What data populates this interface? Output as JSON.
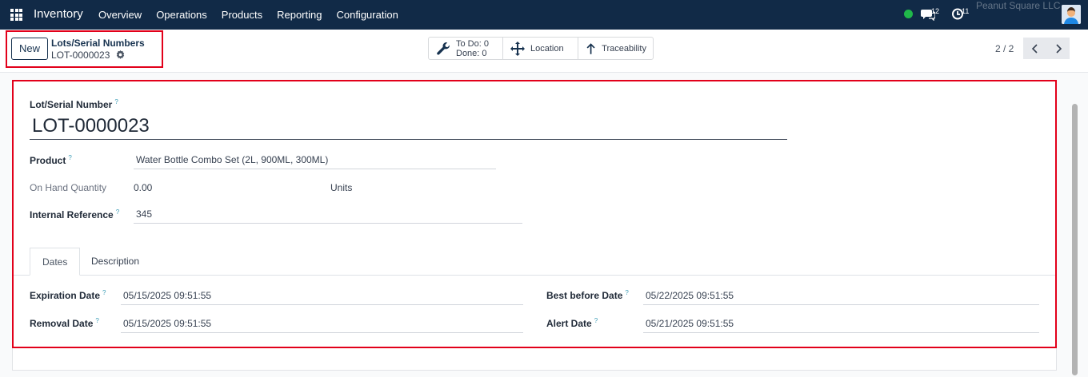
{
  "navbar": {
    "app_name": "Inventory",
    "menu": [
      "Overview",
      "Operations",
      "Products",
      "Reporting",
      "Configuration"
    ],
    "messages_count": "12",
    "activities_count": "11",
    "company": "Peanut Square LLC",
    "status_color": "#20b84a"
  },
  "control_panel": {
    "new_label": "New",
    "breadcrumb_parent": "Lots/Serial Numbers",
    "breadcrumb_current": "LOT-0000023",
    "smart_buttons": {
      "todo_label": "To Do: 0",
      "done_label": "Done: 0",
      "location_label": "Location",
      "traceability_label": "Traceability"
    },
    "pager": "2 / 2"
  },
  "form": {
    "lot_label": "Lot/Serial Number",
    "lot_value": "LOT-0000023",
    "help_mark": "?",
    "product_label": "Product",
    "product_value": "Water Bottle Combo Set (2L, 900ML, 300ML)",
    "on_hand_label": "On Hand Quantity",
    "on_hand_value": "0.00",
    "on_hand_uom": "Units",
    "internal_ref_label": "Internal Reference",
    "internal_ref_value": "345"
  },
  "tabs": [
    "Dates",
    "Description"
  ],
  "dates": {
    "expiration_label": "Expiration Date",
    "expiration_value": "05/15/2025 09:51:55",
    "removal_label": "Removal Date",
    "removal_value": "05/15/2025 09:51:55",
    "best_before_label": "Best before Date",
    "best_before_value": "05/22/2025 09:51:55",
    "alert_label": "Alert Date",
    "alert_value": "05/21/2025 09:51:55"
  },
  "icons": [
    "apps-grid-icon",
    "chat-icon",
    "activity-clock-icon",
    "avatar",
    "gear-icon",
    "wrench-icon",
    "move-arrows-icon",
    "arrow-up-icon",
    "chevron-left-icon",
    "chevron-right-icon"
  ],
  "colors": {
    "navbar": "#112a47",
    "highlight": "#e2001a",
    "help": "#3a9bb5"
  }
}
